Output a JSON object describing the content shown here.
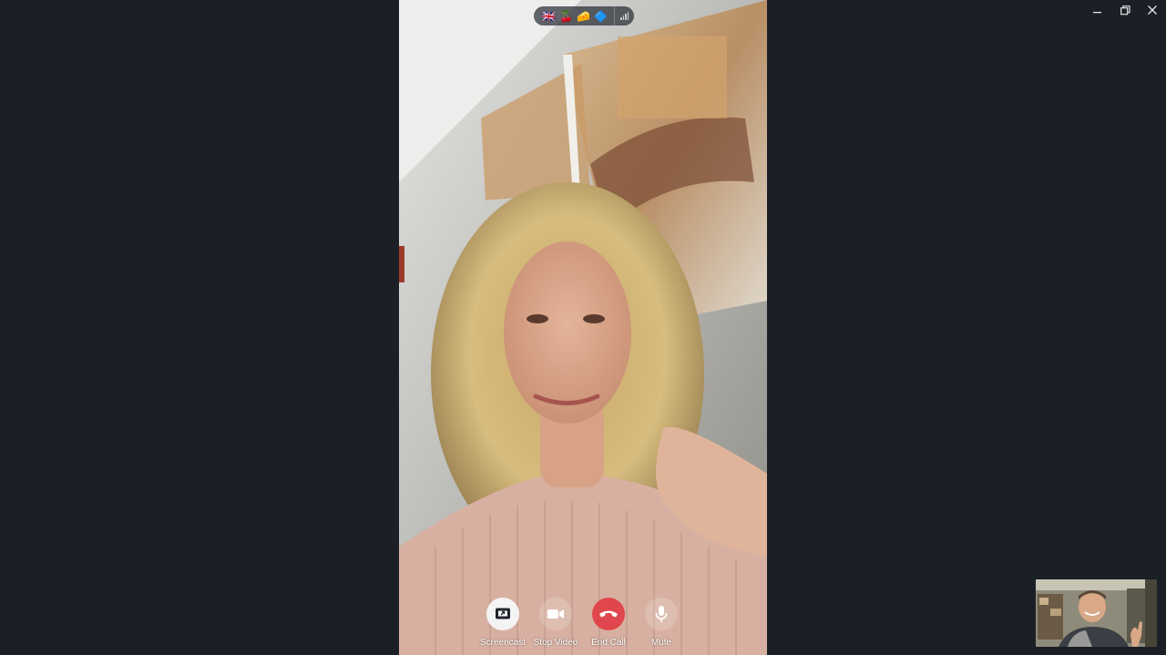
{
  "window": {
    "controls": {
      "minimize_icon": "minimize-icon",
      "restore_icon": "restore-icon",
      "close_icon": "close-icon"
    }
  },
  "encryption": {
    "emojis": [
      "🇬🇧",
      "🍒",
      "🧀",
      "🔷"
    ],
    "signal_icon": "signal-bars-icon"
  },
  "controls": [
    {
      "id": "screencast",
      "label": "Screencast",
      "icon": "screencast-icon"
    },
    {
      "id": "stopvideo",
      "label": "Stop Video",
      "icon": "camera-icon"
    },
    {
      "id": "endcall",
      "label": "End Call",
      "icon": "phone-hangup-icon"
    },
    {
      "id": "mute",
      "label": "Mute",
      "icon": "microphone-icon"
    }
  ],
  "colors": {
    "background": "#1b1f26",
    "end_call": "#e0474c",
    "screencast_active": "#f4f4f4"
  }
}
